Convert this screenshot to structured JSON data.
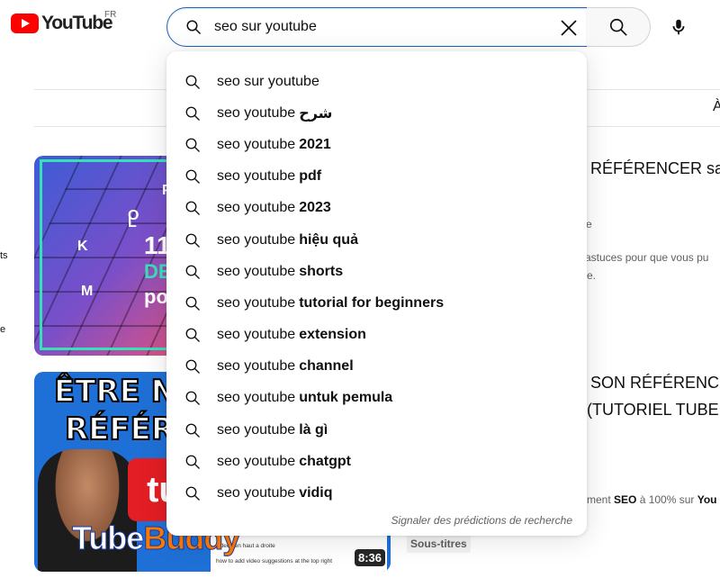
{
  "header": {
    "logo_text": "YouTube",
    "country_code": "FR",
    "search_value": "seo sur youtube"
  },
  "suggestions": [
    {
      "base": "seo sur youtube",
      "rest": ""
    },
    {
      "base": "seo youtube",
      "rest": "شرح"
    },
    {
      "base": "seo youtube",
      "rest": "2021"
    },
    {
      "base": "seo youtube",
      "rest": "pdf"
    },
    {
      "base": "seo youtube",
      "rest": "2023"
    },
    {
      "base": "seo youtube",
      "rest": "hiệu quả"
    },
    {
      "base": "seo youtube",
      "rest": "shorts"
    },
    {
      "base": "seo youtube",
      "rest": "tutorial for beginners"
    },
    {
      "base": "seo youtube",
      "rest": "extension"
    },
    {
      "base": "seo youtube",
      "rest": "channel"
    },
    {
      "base": "seo youtube",
      "rest": "untuk pemula"
    },
    {
      "base": "seo youtube",
      "rest": "là gì"
    },
    {
      "base": "seo youtube",
      "rest": "chatgpt"
    },
    {
      "base": "seo youtube",
      "rest": "vidiq"
    }
  ],
  "report_link": "Signaler des prédictions de recherche",
  "background": {
    "filter_edge": "À",
    "sidebar_fragments": [
      "ts",
      "e"
    ],
    "video1": {
      "title_fragment": "RÉFÉRENCER sa",
      "meta_fragment": "e",
      "desc_line1": "astuces pour que vous pu",
      "desc_line2": "e.",
      "thumb_keys": [
        "P",
        "O",
        "K",
        "L",
        "M"
      ],
      "thumb_text": [
        "11",
        "DE",
        "po"
      ]
    },
    "video2": {
      "title_line1": "SON RÉFÉRENC",
      "title_line2": "(TUTORIEL TUBE",
      "desc_pre": "ment ",
      "desc_bold1": "SEO",
      "desc_mid": " à 100% sur ",
      "desc_bold2": "You",
      "badge": "Sous-titres",
      "duration": "8:36",
      "thumb_line1": "ÊTRE N°",
      "thumb_line2": "RÉFÉRE",
      "thumb_logo": "tu",
      "thumb_brand_a": "Tube",
      "thumb_brand_b": "Buddy",
      "thumb_ui1": "videos en haut a droite",
      "thumb_ui2": "how to add video suggestions at the top right"
    }
  }
}
